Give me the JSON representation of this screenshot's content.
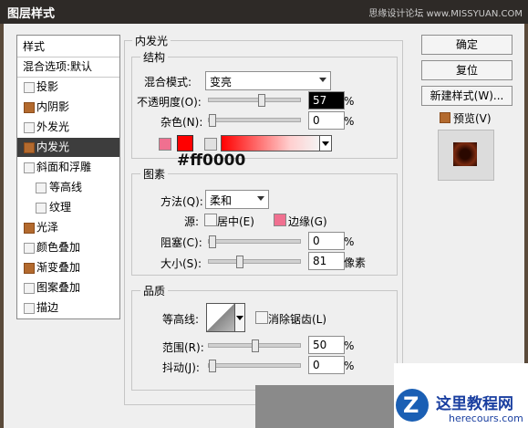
{
  "window": {
    "title": "图层样式",
    "watermark": "思缘设计论坛 www.MISSYUAN.COM"
  },
  "styles_list": {
    "header": "样式",
    "blending": "混合选项:默认",
    "items": [
      {
        "label": "投影",
        "checked": false
      },
      {
        "label": "内阴影",
        "checked": true
      },
      {
        "label": "外发光",
        "checked": false
      },
      {
        "label": "内发光",
        "checked": true,
        "selected": true
      },
      {
        "label": "斜面和浮雕",
        "checked": false
      },
      {
        "label": "等高线",
        "checked": false,
        "sub": true
      },
      {
        "label": "纹理",
        "checked": false,
        "sub": true
      },
      {
        "label": "光泽",
        "checked": true
      },
      {
        "label": "颜色叠加",
        "checked": false
      },
      {
        "label": "渐变叠加",
        "checked": true
      },
      {
        "label": "图案叠加",
        "checked": false
      },
      {
        "label": "描边",
        "checked": false
      }
    ]
  },
  "panel": {
    "title": "内发光",
    "structure": {
      "legend": "结构",
      "blend_mode_label": "混合模式:",
      "blend_mode": "变亮",
      "opacity_label": "不透明度(O):",
      "opacity": "57",
      "opacity_value": 57,
      "noise_label": "杂色(N):",
      "noise": "0",
      "noise_value": 0,
      "percent": "%"
    },
    "color_note": "#ff0000",
    "elements": {
      "legend": "图素",
      "method_label": "方法(Q):",
      "method": "柔和",
      "source_label": "源:",
      "center_label": "居中(E)",
      "edge_label": "边缘(G)",
      "choke_label": "阻塞(C):",
      "choke": "0",
      "choke_value": 0,
      "size_label": "大小(S):",
      "size": "81",
      "size_value": 81,
      "size_unit": "像素",
      "percent": "%"
    },
    "quality": {
      "legend": "品质",
      "contour_label": "等高线:",
      "antialias_label": "消除锯齿(L)",
      "range_label": "范围(R):",
      "range": "50",
      "range_value": 50,
      "jitter_label": "抖动(J):",
      "jitter": "0",
      "jitter_value": 0,
      "percent": "%"
    }
  },
  "buttons": {
    "ok": "确定",
    "reset": "复位",
    "new_style": "新建样式(W)...",
    "preview": "预览(V)"
  },
  "colors": {
    "accent": "#b36a2e",
    "glow": "#ff0000",
    "swatch_pink": "#f07090"
  },
  "logo": {
    "name": "这里教程网",
    "url": "herecours.com"
  }
}
